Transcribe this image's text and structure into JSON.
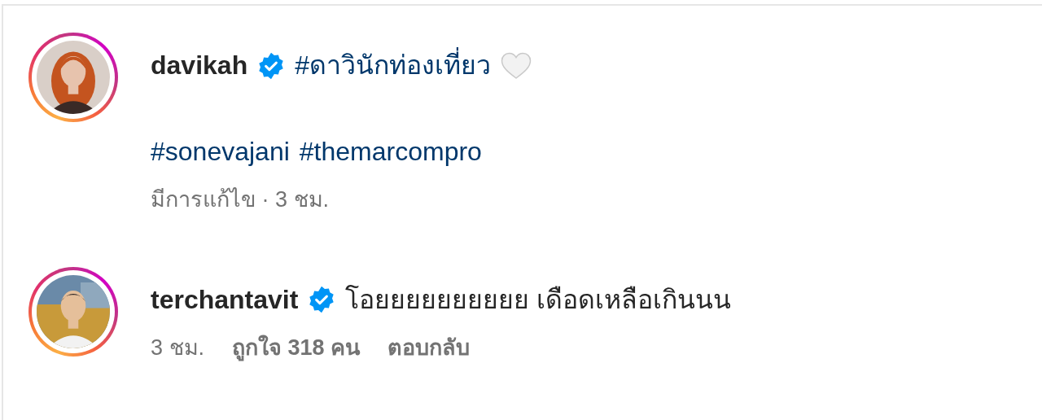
{
  "comments": [
    {
      "username": "davikah",
      "verified": true,
      "avatar": {
        "kind": "picture"
      },
      "lines": [
        {
          "segments": [
            {
              "kind": "hashtag",
              "text": "#ดาวินักท่องเที่ยว"
            },
            {
              "kind": "heart"
            }
          ]
        },
        {
          "space_before": true,
          "segments": [
            {
              "kind": "hashtag",
              "text": "#sonevajani"
            },
            {
              "kind": "hashtag",
              "text": "#themarcompro"
            }
          ]
        }
      ],
      "meta": [
        {
          "kind": "time",
          "text": "มีการแก้ไข · 3 ชม."
        }
      ]
    },
    {
      "username": "terchantavit",
      "verified": true,
      "avatar": {
        "kind": "picture"
      },
      "lines": [
        {
          "segments": [
            {
              "kind": "text",
              "text": "โอยยยยยยยยยย เดือดเหลือเกินนน"
            }
          ]
        }
      ],
      "meta": [
        {
          "kind": "time",
          "text": "3 ชม."
        },
        {
          "kind": "likes",
          "text": "ถูกใจ 318 คน"
        },
        {
          "kind": "reply",
          "text": "ตอบกลับ"
        }
      ]
    }
  ]
}
